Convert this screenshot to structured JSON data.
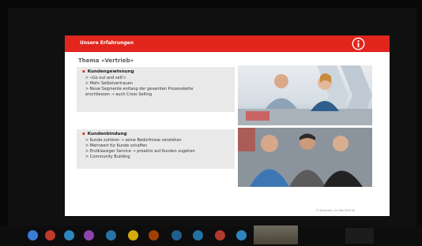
{
  "slide": {
    "header_title": "Unsere Erfahrungen",
    "subtitle": "Thema «Vertrieb»",
    "boxes": [
      {
        "title": "Kundengewinnung",
        "lines": [
          "> «Go out and sell!»",
          "> Mehr Selbstvertrauen",
          "> Neue Segmente entlang der gesamten Prozesskette",
          "   erschliessen → auch Cross Selling"
        ]
      },
      {
        "title": "Kundenbindung",
        "lines": [
          "> Kunde zuhören → seine Bedürfnisse verstehen",
          "> Mehrwert für Kunde schaffen",
          "> Erstklassiger Service → proaktiv auf Kunden zugehen",
          "> Community Building"
        ]
      }
    ],
    "footer": "© Swisscom | 24. Mai 2016     46"
  },
  "taskbar": {
    "label": "",
    "avatars": [
      {
        "initials": "",
        "color": "#3a7bd5"
      },
      {
        "initials": "",
        "color": "#c0392b"
      },
      {
        "initials": "",
        "color": "#2e86c1"
      },
      {
        "initials": "",
        "color": "#8e44ad"
      },
      {
        "initials": "",
        "color": "#2874a6"
      },
      {
        "initials": "",
        "color": "#d4ac0d"
      },
      {
        "initials": "",
        "color": "#a04000"
      },
      {
        "initials": "",
        "color": "#1f618d"
      },
      {
        "initials": "",
        "color": "#2471a3"
      },
      {
        "initials": "",
        "color": "#b03a2e"
      },
      {
        "initials": "",
        "color": "#2e86c1"
      }
    ]
  },
  "colors": {
    "accent": "#e2261d",
    "background": "#080808"
  },
  "icons": {
    "logo": "brand-logo-icon"
  }
}
